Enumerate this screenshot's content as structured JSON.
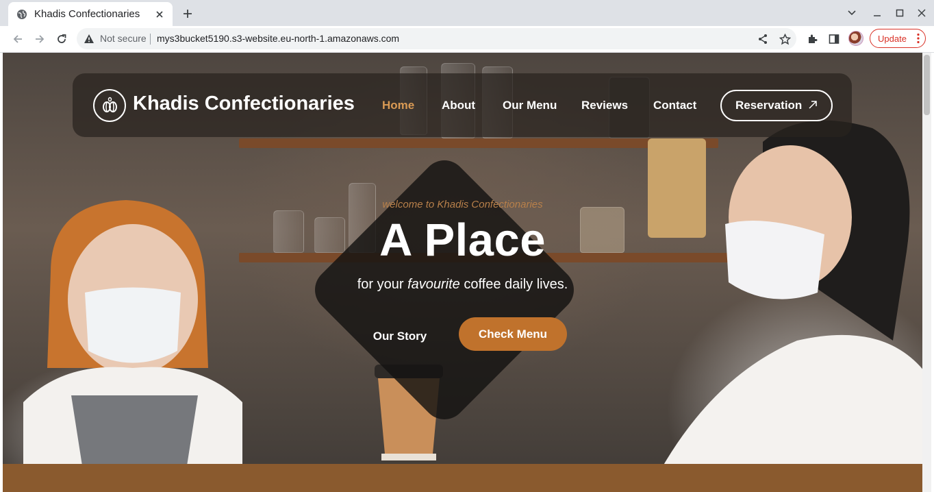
{
  "browser": {
    "tab_title": "Khadis Confectionaries",
    "security_label": "Not secure",
    "url": "mys3bucket5190.s3-website.eu-north-1.amazonaws.com",
    "update_label": "Update"
  },
  "site": {
    "brand": "Khadis Confectionaries",
    "nav": [
      "Home",
      "About",
      "Our Menu",
      "Reviews",
      "Contact"
    ],
    "active_nav": "Home",
    "reservation_label": "Reservation",
    "accent_color": "#c0722c",
    "hero": {
      "welcome": "welcome to Khadis Confectionaries",
      "title": "A Place",
      "subtitle_pre": "for your ",
      "subtitle_em": "favourite",
      "subtitle_post": " coffee daily lives.",
      "story_label": "Our Story",
      "menu_label": "Check Menu"
    }
  }
}
